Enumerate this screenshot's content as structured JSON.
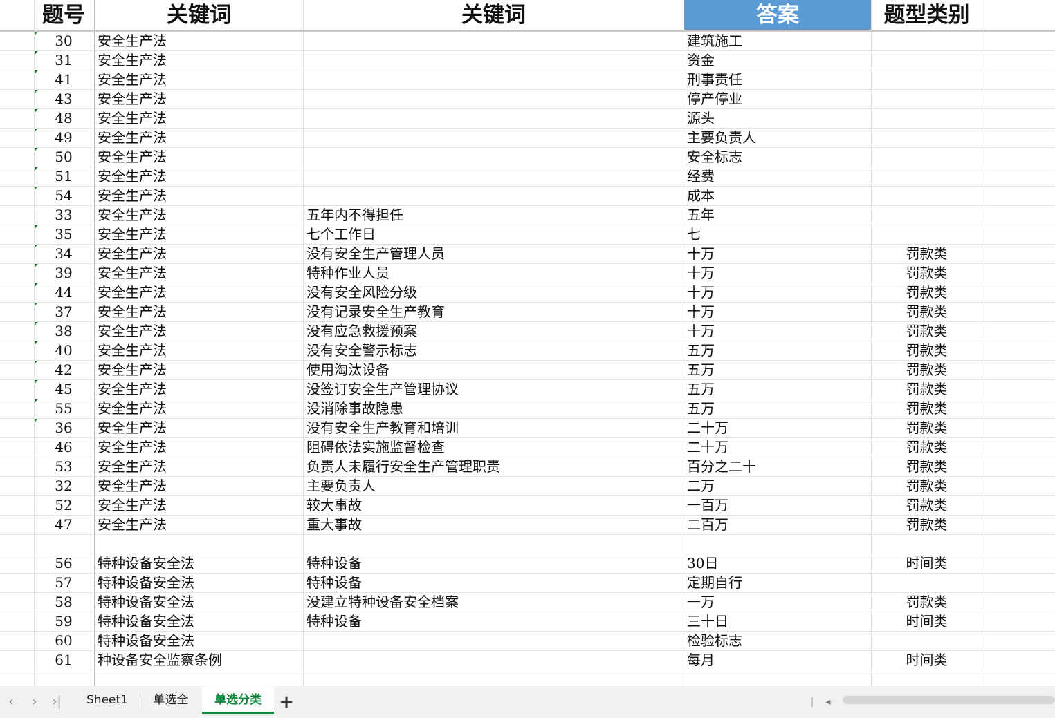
{
  "sheet": {
    "headers": [
      "题号",
      "关键词",
      "关键词",
      "答案",
      "题型类别"
    ],
    "rows": [
      {
        "id": "30",
        "law": "安全生产法",
        "keyword": "",
        "answer": "建筑施工",
        "category": "",
        "flag": true
      },
      {
        "id": "31",
        "law": "安全生产法",
        "keyword": "",
        "answer": "资金",
        "category": "",
        "flag": true
      },
      {
        "id": "41",
        "law": "安全生产法",
        "keyword": "",
        "answer": "刑事责任",
        "category": "",
        "flag": true
      },
      {
        "id": "43",
        "law": "安全生产法",
        "keyword": "",
        "answer": "停产停业",
        "category": "",
        "flag": true
      },
      {
        "id": "48",
        "law": "安全生产法",
        "keyword": "",
        "answer": "源头",
        "category": "",
        "flag": true
      },
      {
        "id": "49",
        "law": "安全生产法",
        "keyword": "",
        "answer": "主要负责人",
        "category": "",
        "flag": true
      },
      {
        "id": "50",
        "law": "安全生产法",
        "keyword": "",
        "answer": "安全标志",
        "category": "",
        "flag": true
      },
      {
        "id": "51",
        "law": "安全生产法",
        "keyword": "",
        "answer": "经费",
        "category": "",
        "flag": true
      },
      {
        "id": "54",
        "law": "安全生产法",
        "keyword": "",
        "answer": "成本",
        "category": "",
        "flag": true
      },
      {
        "id": "33",
        "law": "安全生产法",
        "keyword": "五年内不得担任",
        "answer": "五年",
        "category": "",
        "flag": false
      },
      {
        "id": "35",
        "law": "安全生产法",
        "keyword": "七个工作日",
        "answer": "七",
        "category": "",
        "flag": true
      },
      {
        "id": "34",
        "law": "安全生产法",
        "keyword": "没有安全生产管理人员",
        "answer": "十万",
        "category": "罚款类",
        "flag": true
      },
      {
        "id": "39",
        "law": "安全生产法",
        "keyword": "特种作业人员",
        "answer": "十万",
        "category": "罚款类",
        "flag": true
      },
      {
        "id": "44",
        "law": "安全生产法",
        "keyword": "没有安全风险分级",
        "answer": "十万",
        "category": "罚款类",
        "flag": true
      },
      {
        "id": "37",
        "law": "安全生产法",
        "keyword": "没有记录安全生产教育",
        "answer": "十万",
        "category": "罚款类",
        "flag": true
      },
      {
        "id": "38",
        "law": "安全生产法",
        "keyword": "没有应急救援预案",
        "answer": "十万",
        "category": "罚款类",
        "flag": true
      },
      {
        "id": "40",
        "law": "安全生产法",
        "keyword": "没有安全警示标志",
        "answer": "五万",
        "category": "罚款类",
        "flag": true
      },
      {
        "id": "42",
        "law": "安全生产法",
        "keyword": "使用淘汰设备",
        "answer": "五万",
        "category": "罚款类",
        "flag": true
      },
      {
        "id": "45",
        "law": "安全生产法",
        "keyword": "没签订安全生产管理协议",
        "answer": "五万",
        "category": "罚款类",
        "flag": true
      },
      {
        "id": "55",
        "law": "安全生产法",
        "keyword": "没消除事故隐患",
        "answer": "五万",
        "category": "罚款类",
        "flag": true
      },
      {
        "id": "36",
        "law": "安全生产法",
        "keyword": "没有安全生产教育和培训",
        "answer": "二十万",
        "category": "罚款类",
        "flag": true
      },
      {
        "id": "46",
        "law": "安全生产法",
        "keyword": "阻碍依法实施监督检查",
        "answer": "二十万",
        "category": "罚款类",
        "flag": false
      },
      {
        "id": "53",
        "law": "安全生产法",
        "keyword": "负责人未履行安全生产管理职责",
        "answer": "百分之二十",
        "category": "罚款类",
        "flag": false
      },
      {
        "id": "32",
        "law": "安全生产法",
        "keyword": "主要负责人",
        "answer": "二万",
        "category": "罚款类",
        "flag": false
      },
      {
        "id": "52",
        "law": "安全生产法",
        "keyword": "较大事故",
        "answer": "一百万",
        "category": "罚款类",
        "flag": false
      },
      {
        "id": "47",
        "law": "安全生产法",
        "keyword": "重大事故",
        "answer": "二百万",
        "category": "罚款类",
        "flag": false
      },
      {
        "id": "",
        "law": "",
        "keyword": "",
        "answer": "",
        "category": "",
        "flag": false
      },
      {
        "id": "56",
        "law": "特种设备安全法",
        "keyword": "特种设备",
        "answer": "30日",
        "category": "时间类",
        "flag": false
      },
      {
        "id": "57",
        "law": "特种设备安全法",
        "keyword": "特种设备",
        "answer": "定期自行",
        "category": "",
        "flag": false
      },
      {
        "id": "58",
        "law": "特种设备安全法",
        "keyword": "没建立特种设备安全档案",
        "answer": "一万",
        "category": "罚款类",
        "flag": false
      },
      {
        "id": "59",
        "law": "特种设备安全法",
        "keyword": "特种设备",
        "answer": "三十日",
        "category": "时间类",
        "flag": false
      },
      {
        "id": "60",
        "law": "特种设备安全法",
        "keyword": "",
        "answer": "检验标志",
        "category": "",
        "flag": false
      },
      {
        "id": "61",
        "law": "种设备安全监察条例",
        "keyword": "",
        "answer": "每月",
        "category": "时间类",
        "flag": false
      },
      {
        "id": "",
        "law": "",
        "keyword": "",
        "answer": "",
        "category": "",
        "flag": false
      }
    ]
  },
  "tabbar": {
    "nav_first": "‹",
    "nav_next": "›",
    "nav_last": "›|",
    "tabs": [
      {
        "label": "Sheet1",
        "active": false
      },
      {
        "label": "单选全",
        "active": false
      },
      {
        "label": "单选分类",
        "active": true
      }
    ],
    "add_label": "+",
    "scroll_sep": "|",
    "scroll_left": "◂"
  },
  "colors": {
    "header_highlight": "#5b9bd5",
    "active_tab": "#0f8a3c",
    "comment_marker": "#1f7a33"
  }
}
